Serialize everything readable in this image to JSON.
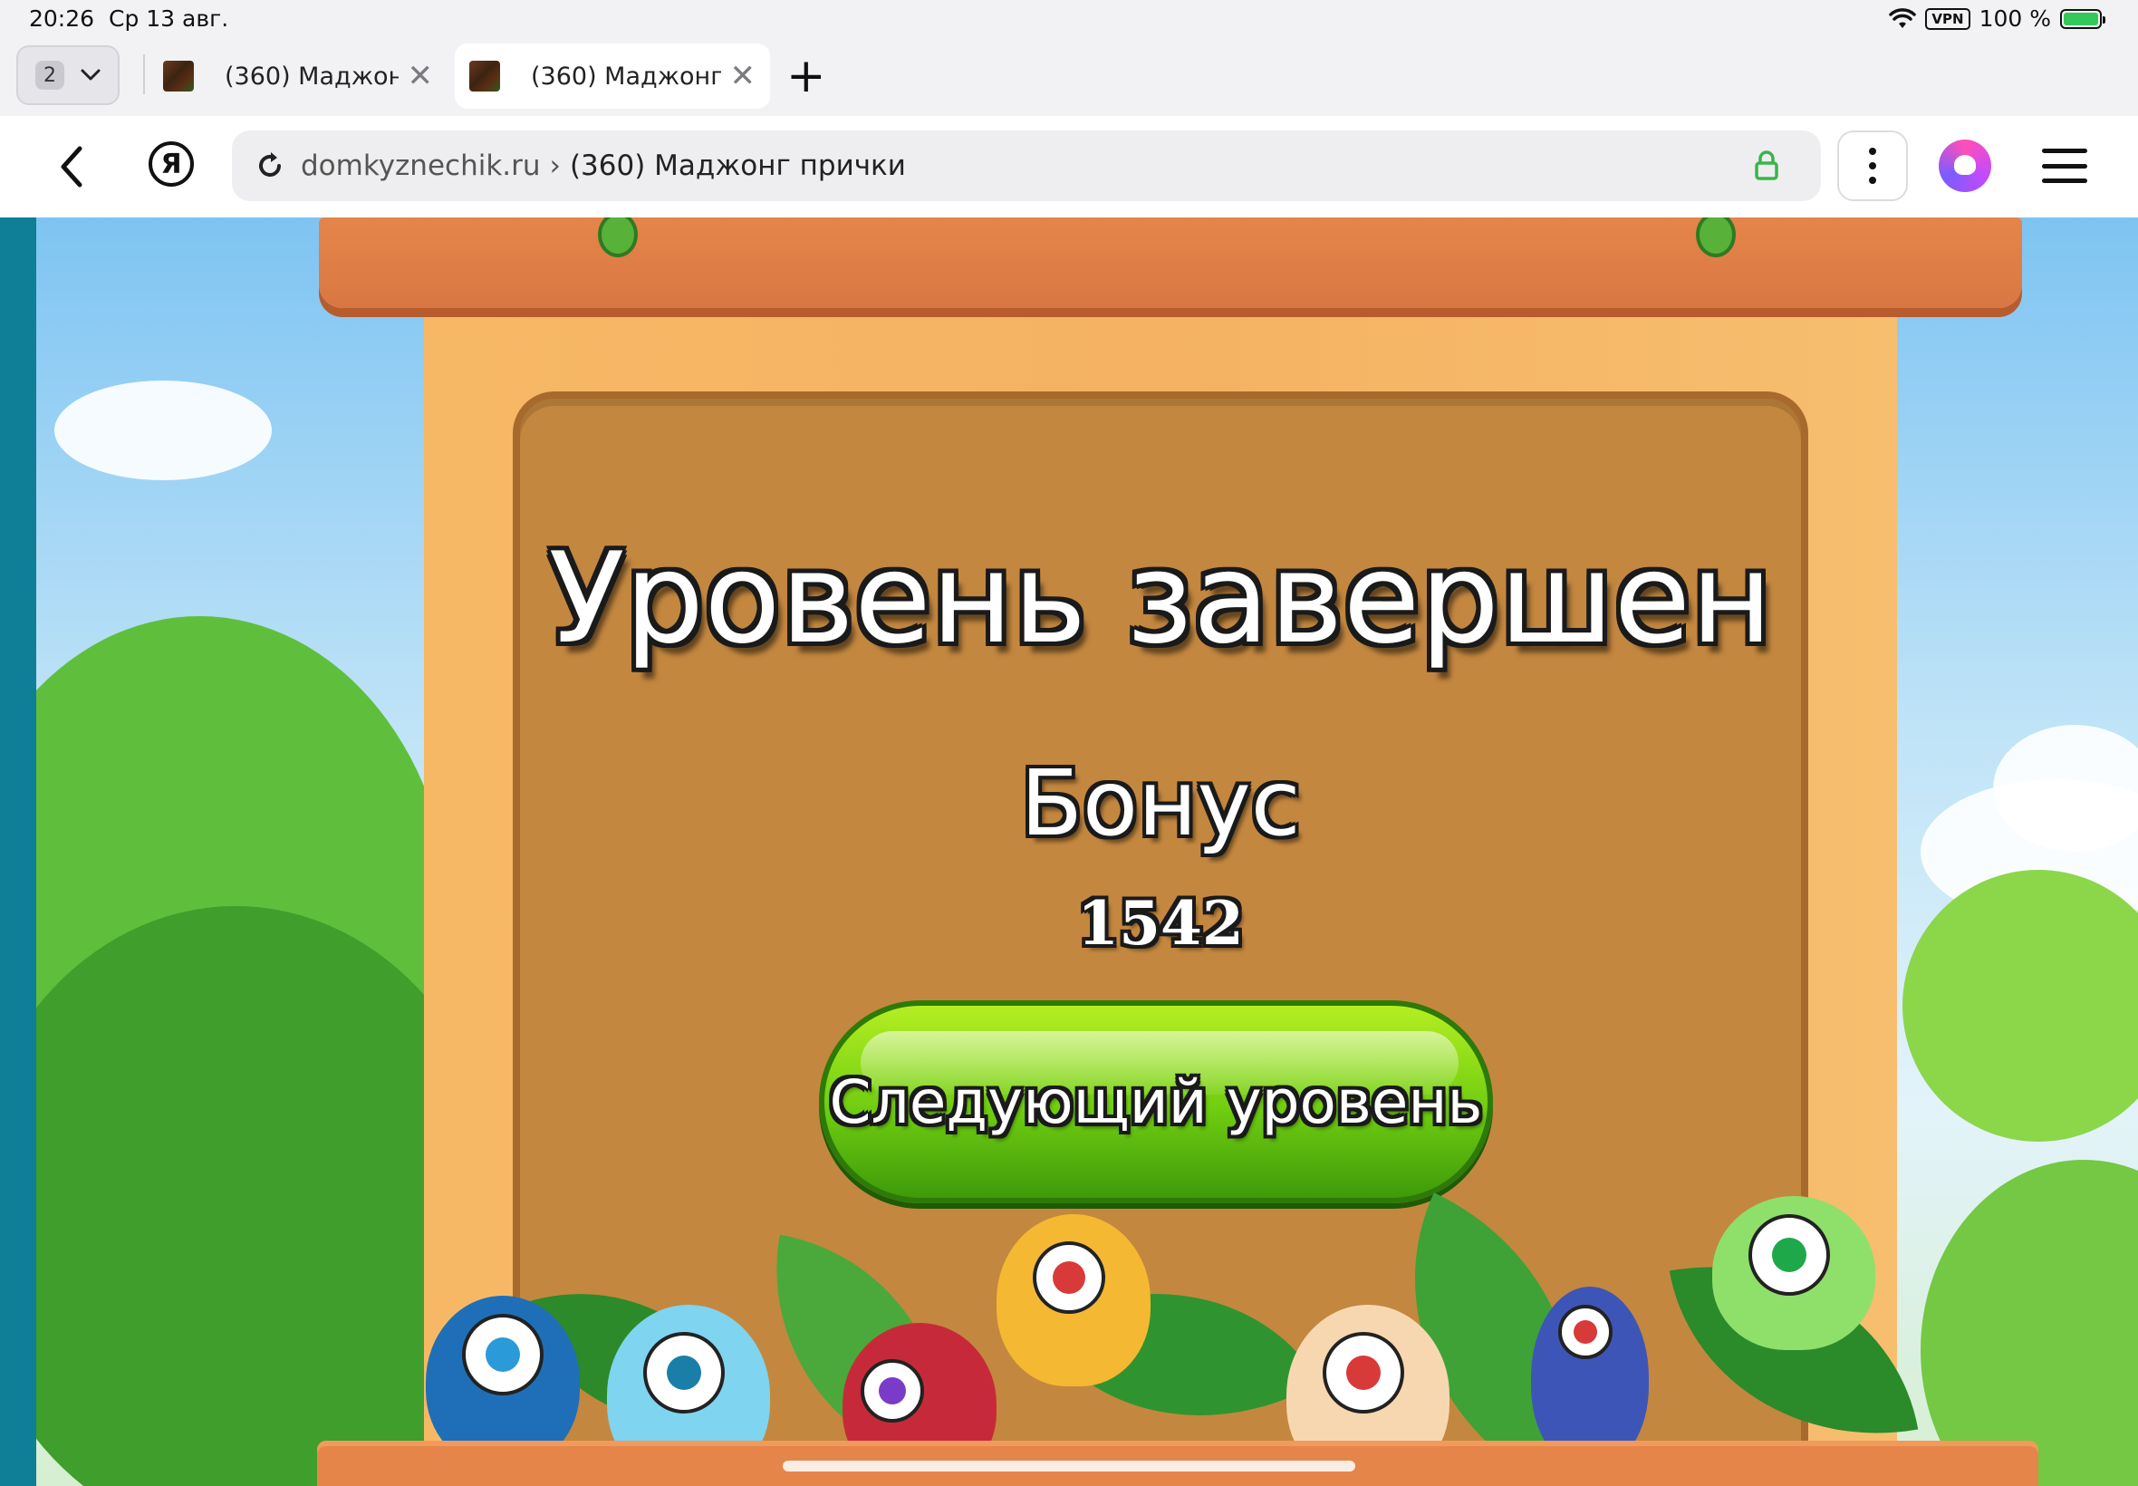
{
  "status_bar": {
    "time": "20:26",
    "date": "Ср 13 авг.",
    "vpn": "VPN",
    "battery": "100 %"
  },
  "tabs": {
    "count": "2",
    "items": [
      {
        "title": "(360) Маджонг",
        "active": false
      },
      {
        "title": "(360) Маджонг...",
        "active": true
      }
    ]
  },
  "address_bar": {
    "domain": "domkyznechik.ru",
    "separator": "›",
    "page_title": "(360) Маджонг прички"
  },
  "browser_brand": "Я",
  "game": {
    "title": "Уровень завершен",
    "bonus_label": "Бонус",
    "bonus_value": "1542",
    "next_button_label": "Следующий уровень"
  },
  "colors": {
    "button_green": "#6fcc10",
    "sign_brown": "#c4873f",
    "frame_orange": "#f4b262",
    "plank_orange": "#d97743",
    "left_strip": "#0f7f98"
  },
  "icons": [
    "wifi-icon",
    "battery-icon",
    "chevron-down-icon",
    "close-icon",
    "plus-icon",
    "back-icon",
    "reload-icon",
    "lock-icon",
    "more-vertical-icon",
    "alice-icon",
    "hamburger-icon"
  ]
}
